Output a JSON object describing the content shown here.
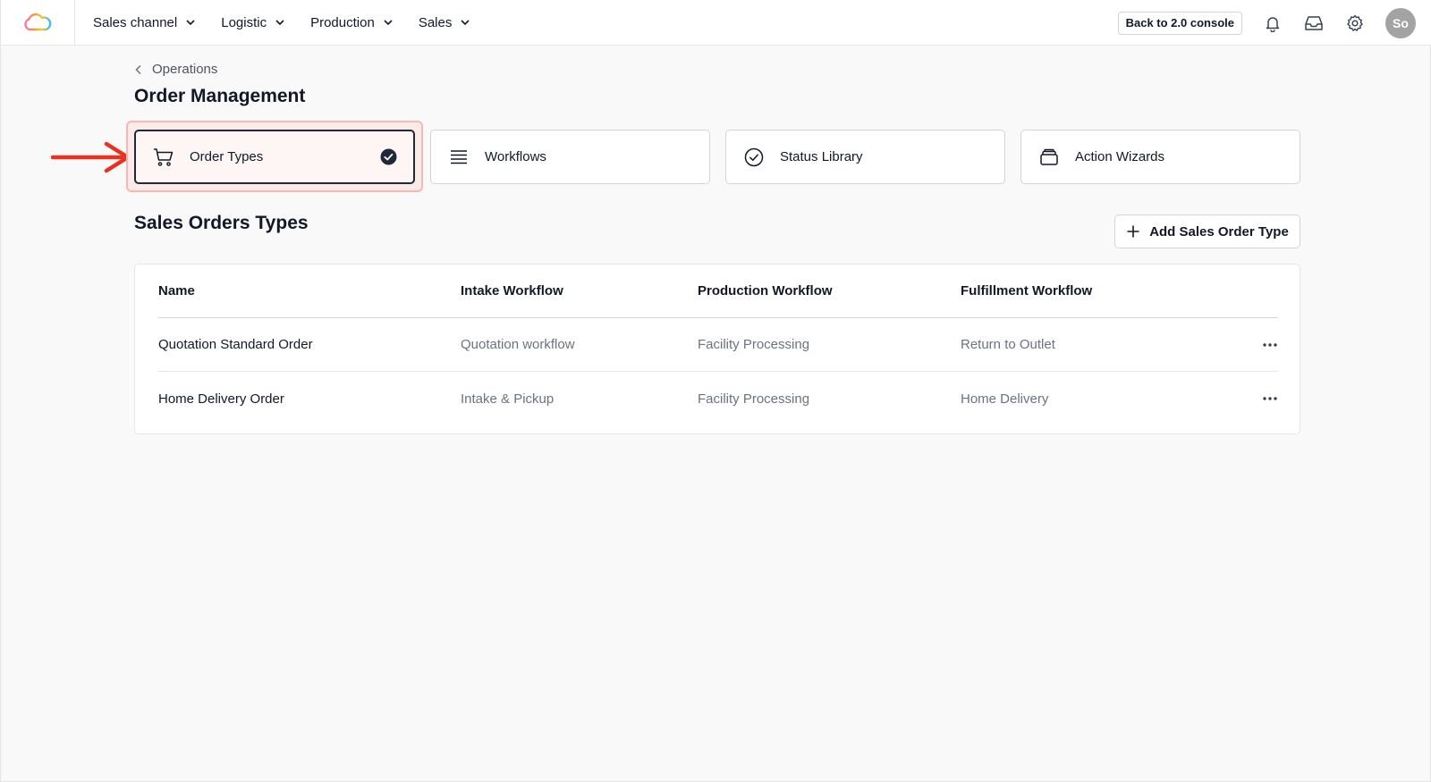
{
  "nav": {
    "items": [
      {
        "label": "Sales channel"
      },
      {
        "label": "Logistic"
      },
      {
        "label": "Production"
      },
      {
        "label": "Sales"
      }
    ],
    "console_button": "Back to 2.0 console",
    "avatar_initials": "So"
  },
  "breadcrumb": {
    "parent": "Operations"
  },
  "page": {
    "title": "Order Management"
  },
  "tabs": [
    {
      "label": "Order Types",
      "icon": "cart-icon",
      "selected": true
    },
    {
      "label": "Workflows",
      "icon": "list-icon"
    },
    {
      "label": "Status Library",
      "icon": "check-circle-icon"
    },
    {
      "label": "Action Wizards",
      "icon": "stack-icon"
    }
  ],
  "section": {
    "title": "Sales Orders Types",
    "add_button": "Add Sales Order Type"
  },
  "table": {
    "columns": [
      "Name",
      "Intake Workflow",
      "Production Workflow",
      "Fulfillment Workflow"
    ],
    "rows": [
      {
        "name": "Quotation Standard Order",
        "intake": "Quotation workflow",
        "production": "Facility Processing",
        "fulfillment": "Return to Outlet"
      },
      {
        "name": "Home Delivery Order",
        "intake": "Intake & Pickup",
        "production": "Facility Processing",
        "fulfillment": "Home Delivery"
      }
    ]
  },
  "colors": {
    "annotation_arrow": "#e8311f",
    "highlight_border": "#f5b8b3"
  }
}
